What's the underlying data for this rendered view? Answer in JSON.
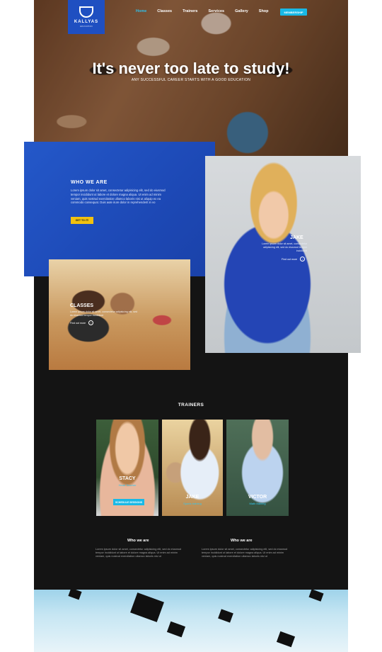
{
  "brand": {
    "name": "KALLYAS",
    "tagline": "EDUCATION"
  },
  "nav": {
    "items": [
      "Home",
      "Classes",
      "Trainers",
      "Services",
      "Gallery",
      "Shop"
    ],
    "active": 0,
    "membership_label": "MEMBERSHIP"
  },
  "hero": {
    "title": "It's never too late to study!",
    "subtitle": "ANY SUCCESSFUL CAREER STARTS WITH A GOOD EDUCATION"
  },
  "who": {
    "title": "WHO WE ARE",
    "text": "Lorem ipsum dolor sit amet, consectetur adipisicing elit, sed do eiusmod tempor incididunt ut labore et dolore magna aliqua. Ut enim ad minim veniam, quis nostrud exercitation ullamco laboris nisi ut aliquip ex ea commodo consequat. Duis aute irure dolor in reprehenderit in vo",
    "button": "GET TO IT!"
  },
  "jake_feature": {
    "name": "JAKE",
    "text": "Lorem ipsum dolor sit amet, consectetur adipisicing elit, sed do eiusmod tempor incididunt",
    "more": "Find out more"
  },
  "classes_feature": {
    "title": "CLASSES",
    "text": "Lorem ipsum dolor sit amet, consectetur adipisicing elit, sed do eiusmod tempor incididunt",
    "more": "Find out more"
  },
  "trainers": {
    "title": "TRAINERS",
    "cards": [
      {
        "name": "STACY",
        "role": "Head Teacher",
        "button": "SCHEDULE SESSIONS"
      },
      {
        "name": "JAKE",
        "role": "Sports training"
      },
      {
        "name": "VICTOR",
        "role": "Math training"
      }
    ]
  },
  "columns": [
    {
      "title": "Who we are",
      "text": "Lorem ipsum dolor sit amet, consectetur adipisicing elit, sed do eiusmod tempor incididunt ut labore et dolore magna aliqua. Ut enim ad minim veniam, quis nostrud exercitation ullamco laboris nisi ut"
    },
    {
      "title": "Who we are",
      "text": "Lorem ipsum dolor sit amet, consectetur adipisicing elit, sed do eiusmod tempor incididunt ut labore et dolore magna aliqua. Ut enim ad minim veniam, quis nostrud exercitation ullamco laboris nisi ut"
    }
  ],
  "colors": {
    "primary_blue": "#1f4fc1",
    "accent_cyan": "#19b9e6",
    "button_yellow": "#f2c20f",
    "dark_bg": "#141414"
  }
}
